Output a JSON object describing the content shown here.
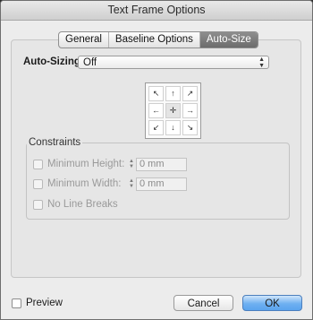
{
  "window": {
    "title": "Text Frame Options"
  },
  "tabs": [
    {
      "label": "General",
      "active": false
    },
    {
      "label": "Baseline Options",
      "active": false
    },
    {
      "label": "Auto-Size",
      "active": true
    }
  ],
  "auto_sizing": {
    "label": "Auto-Sizing",
    "value": "Off"
  },
  "reference_point_grid": {
    "glyphs": [
      "↖",
      "↑",
      "↗",
      "←",
      "✛",
      "→",
      "↙",
      "↓",
      "↘"
    ],
    "icon": "reference-point-grid"
  },
  "constraints": {
    "legend": "Constraints",
    "min_height": {
      "label": "Minimum Height:",
      "value": "0 mm",
      "checked": false,
      "enabled": false
    },
    "min_width": {
      "label": "Minimum Width:",
      "value": "0 mm",
      "checked": false,
      "enabled": false
    },
    "no_line_breaks": {
      "label": "No Line Breaks",
      "checked": false,
      "enabled": false
    }
  },
  "footer": {
    "preview_label": "Preview",
    "cancel_label": "Cancel",
    "ok_label": "OK"
  },
  "colors": {
    "active_tab": "#7a7a7a",
    "primary_button": "#6fb0f1",
    "dialog_bg": "#ececec"
  }
}
